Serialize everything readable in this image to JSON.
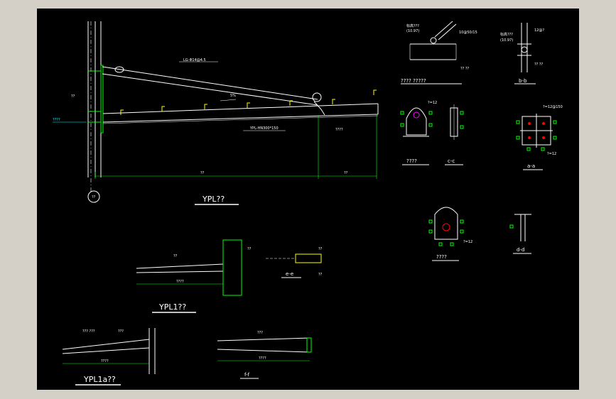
{
  "viewport": {
    "background": "#000000",
    "frame": "#d4d0c8"
  },
  "colors": {
    "line": "#ffffff",
    "member": "#00ff00",
    "dim": "#ffff00",
    "mark": "#ff0000",
    "note": "#00ffff",
    "accent": "#ff00ff"
  },
  "views": {
    "main": {
      "title": "YPL??",
      "rod_label": "LG-Φ14@4.5",
      "beam_label": "YPL-HN300*150",
      "slope_label": "5%",
      "note_left": "????",
      "dim_left": "??",
      "dim_right": "??",
      "axis_label": "??"
    },
    "detail_top": {
      "title": "???? ?????",
      "label_1": "标高???",
      "label_2": "(10.97)",
      "label_3": "10@50/15",
      "label_4": "?? ??"
    },
    "section_bb": {
      "title": "b-b",
      "label_1": "标高???",
      "label_2": "(10.97)",
      "label_3": "12@?",
      "label_4": "?? ??"
    },
    "detail_lug": {
      "title": "????",
      "label": "?=12"
    },
    "section_cc": {
      "title": "c-c"
    },
    "section_aa": {
      "title": "a-a",
      "label_1": "?=12@150",
      "label_2": "?=12"
    },
    "detail_plate": {
      "title": "????",
      "label": "?=12"
    },
    "section_dd": {
      "title": "d-d"
    },
    "ypl1": {
      "title": "YPL1??",
      "dim": "????",
      "label": "??"
    },
    "section_ee": {
      "title": "e-e"
    },
    "ypl1a": {
      "title": "YPL1a??",
      "label_1": "??? ???",
      "label_2": "???",
      "dim": "????"
    },
    "section_ff": {
      "title": "f-f",
      "label": "???",
      "dim": "????"
    }
  }
}
